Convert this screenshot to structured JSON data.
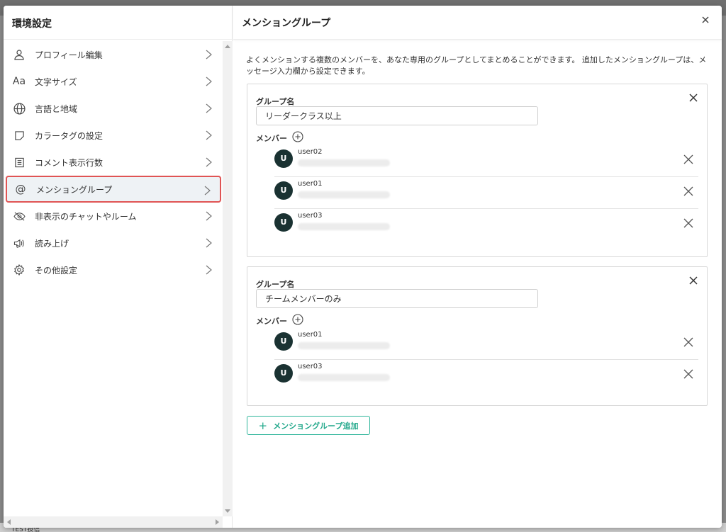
{
  "background": {
    "footer_text": "TEST投信"
  },
  "left": {
    "title": "環境設定",
    "items": [
      {
        "label": "プロフィール編集",
        "icon": "person-icon"
      },
      {
        "label": "文字サイズ",
        "icon": "font-size-icon",
        "icon_text": "Aa"
      },
      {
        "label": "言語と地域",
        "icon": "globe-icon"
      },
      {
        "label": "カラータグの設定",
        "icon": "tag-icon"
      },
      {
        "label": "コメント表示行数",
        "icon": "list-icon"
      },
      {
        "label": "メンショングループ",
        "icon": "at-icon",
        "icon_text": "@",
        "active": true
      },
      {
        "label": "非表示のチャットやルーム",
        "icon": "eye-off-icon"
      },
      {
        "label": "読み上げ",
        "icon": "megaphone-icon"
      },
      {
        "label": "その他設定",
        "icon": "gear-icon"
      }
    ]
  },
  "right": {
    "title": "メンショングループ",
    "description": "よくメンションする複数のメンバーを、あなた専用のグループとしてまとめることができます。 追加したメンショングループは、メッセージ入力欄から設定できます。",
    "group_name_label": "グループ名",
    "member_label": "メンバー",
    "groups": [
      {
        "name": "リーダークラス以上",
        "members": [
          {
            "initial": "U",
            "name": "user02"
          },
          {
            "initial": "U",
            "name": "user01"
          },
          {
            "initial": "U",
            "name": "user03"
          }
        ]
      },
      {
        "name": "チームメンバーのみ",
        "members": [
          {
            "initial": "U",
            "name": "user01"
          },
          {
            "initial": "U",
            "name": "user03"
          }
        ]
      }
    ],
    "add_group_label": "メンショングループ追加"
  },
  "colors": {
    "accent": "#22a88b",
    "active_border": "#e05454",
    "avatar_bg": "#1a3232"
  }
}
